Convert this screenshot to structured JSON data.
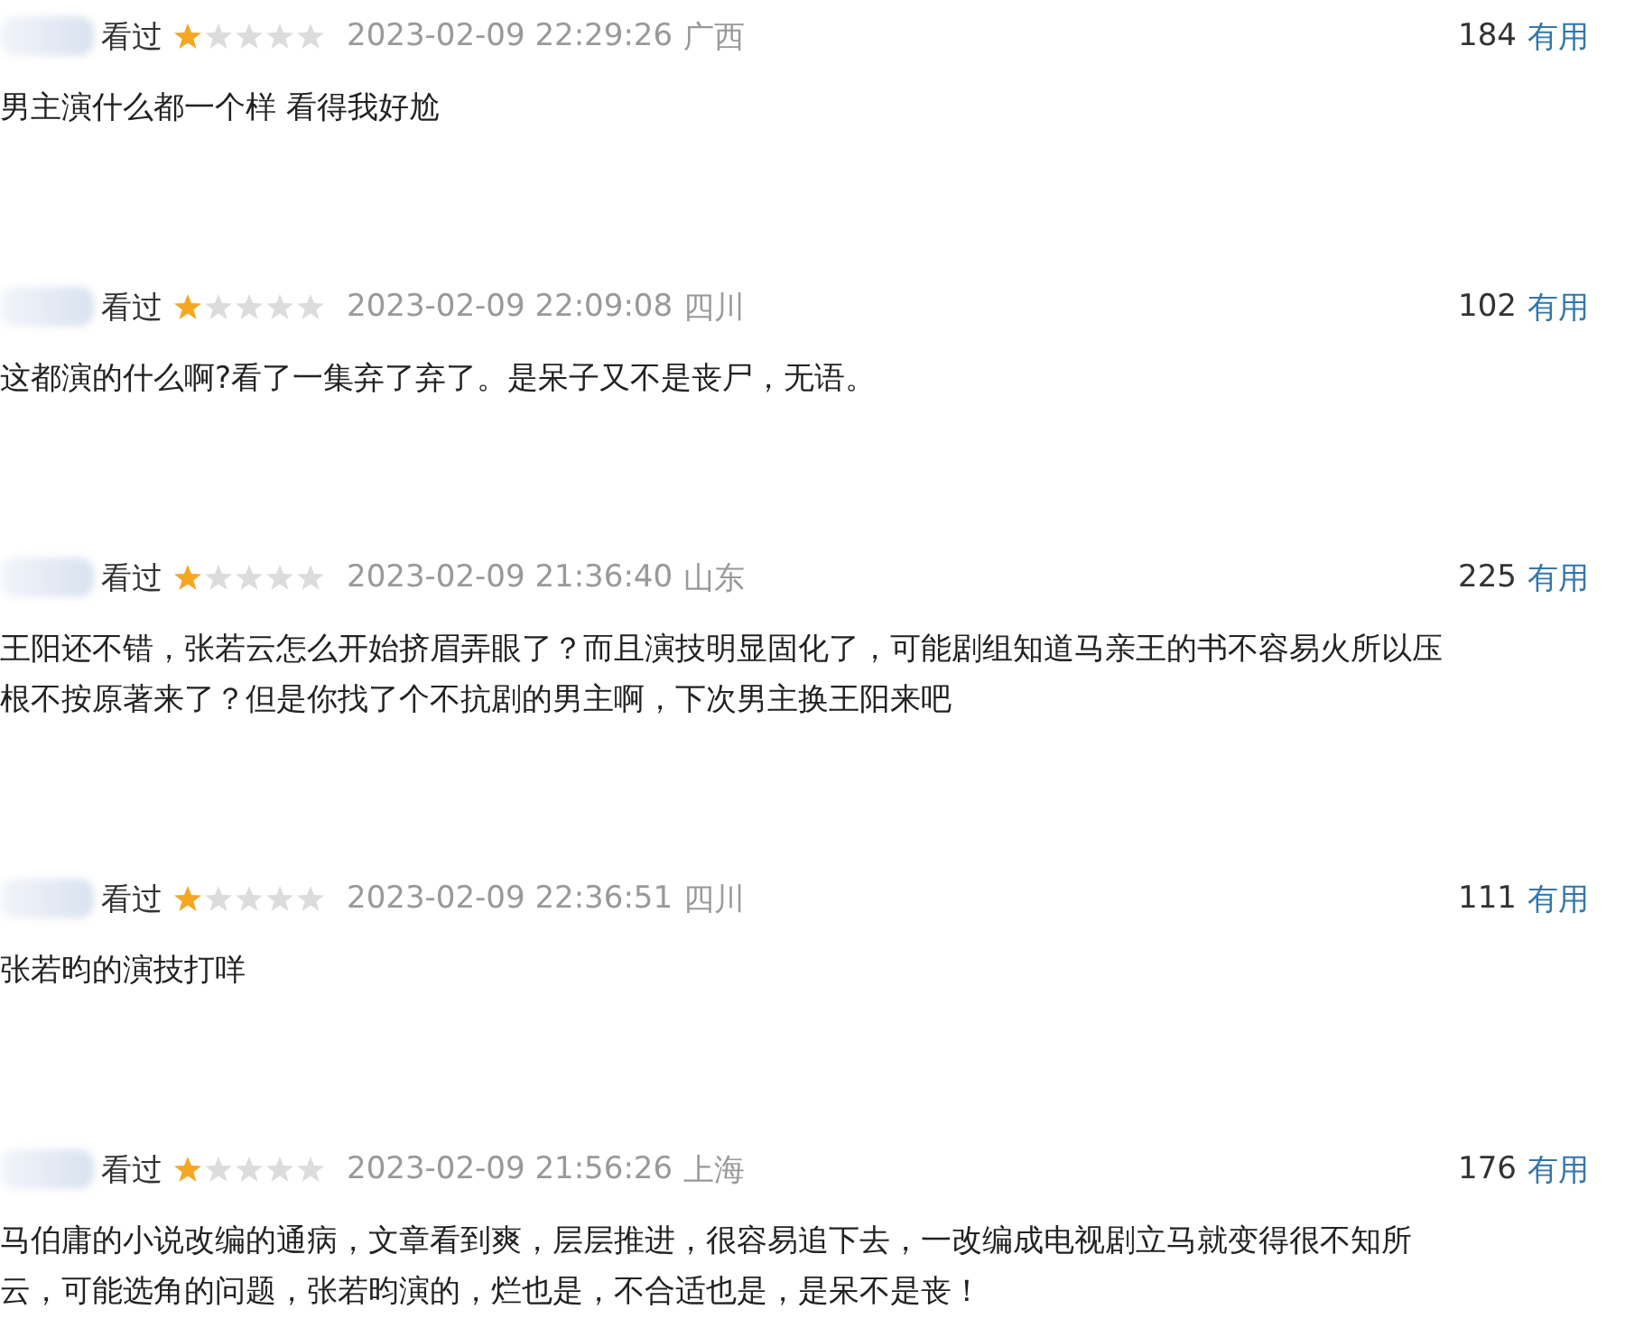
{
  "reviews": [
    {
      "status": "看过",
      "stars": 1,
      "time": "2023-02-09 22:29:26",
      "location": "广西",
      "votes": "184",
      "useful": "有用",
      "lines": [
        "男主演什么都一个样 看得我好尬"
      ]
    },
    {
      "status": "看过",
      "stars": 1,
      "time": "2023-02-09 22:09:08",
      "location": "四川",
      "votes": "102",
      "useful": "有用",
      "lines": [
        "这都演的什么啊?看了一集弃了弃了。是呆子又不是丧尸，无语。"
      ]
    },
    {
      "status": "看过",
      "stars": 1,
      "time": "2023-02-09 21:36:40",
      "location": "山东",
      "votes": "225",
      "useful": "有用",
      "lines": [
        "王阳还不错，张若云怎么开始挤眉弄眼了？而且演技明显固化了，可能剧组知道马亲王的书不容易火所以压",
        "根不按原著来了？但是你找了个不抗剧的男主啊，下次男主换王阳来吧"
      ]
    },
    {
      "status": "看过",
      "stars": 1,
      "time": "2023-02-09 22:36:51",
      "location": "四川",
      "votes": "111",
      "useful": "有用",
      "lines": [
        "张若昀的演技打咩"
      ]
    },
    {
      "status": "看过",
      "stars": 1,
      "time": "2023-02-09 21:56:26",
      "location": "上海",
      "votes": "176",
      "useful": "有用",
      "lines": [
        "马伯庸的小说改编的通病，文章看到爽，层层推进，很容易追下去，一改编成电视剧立马就变得很不知所",
        "云，可能选角的问题，张若昀演的，烂也是，不合适也是，是呆不是丧！"
      ]
    }
  ]
}
